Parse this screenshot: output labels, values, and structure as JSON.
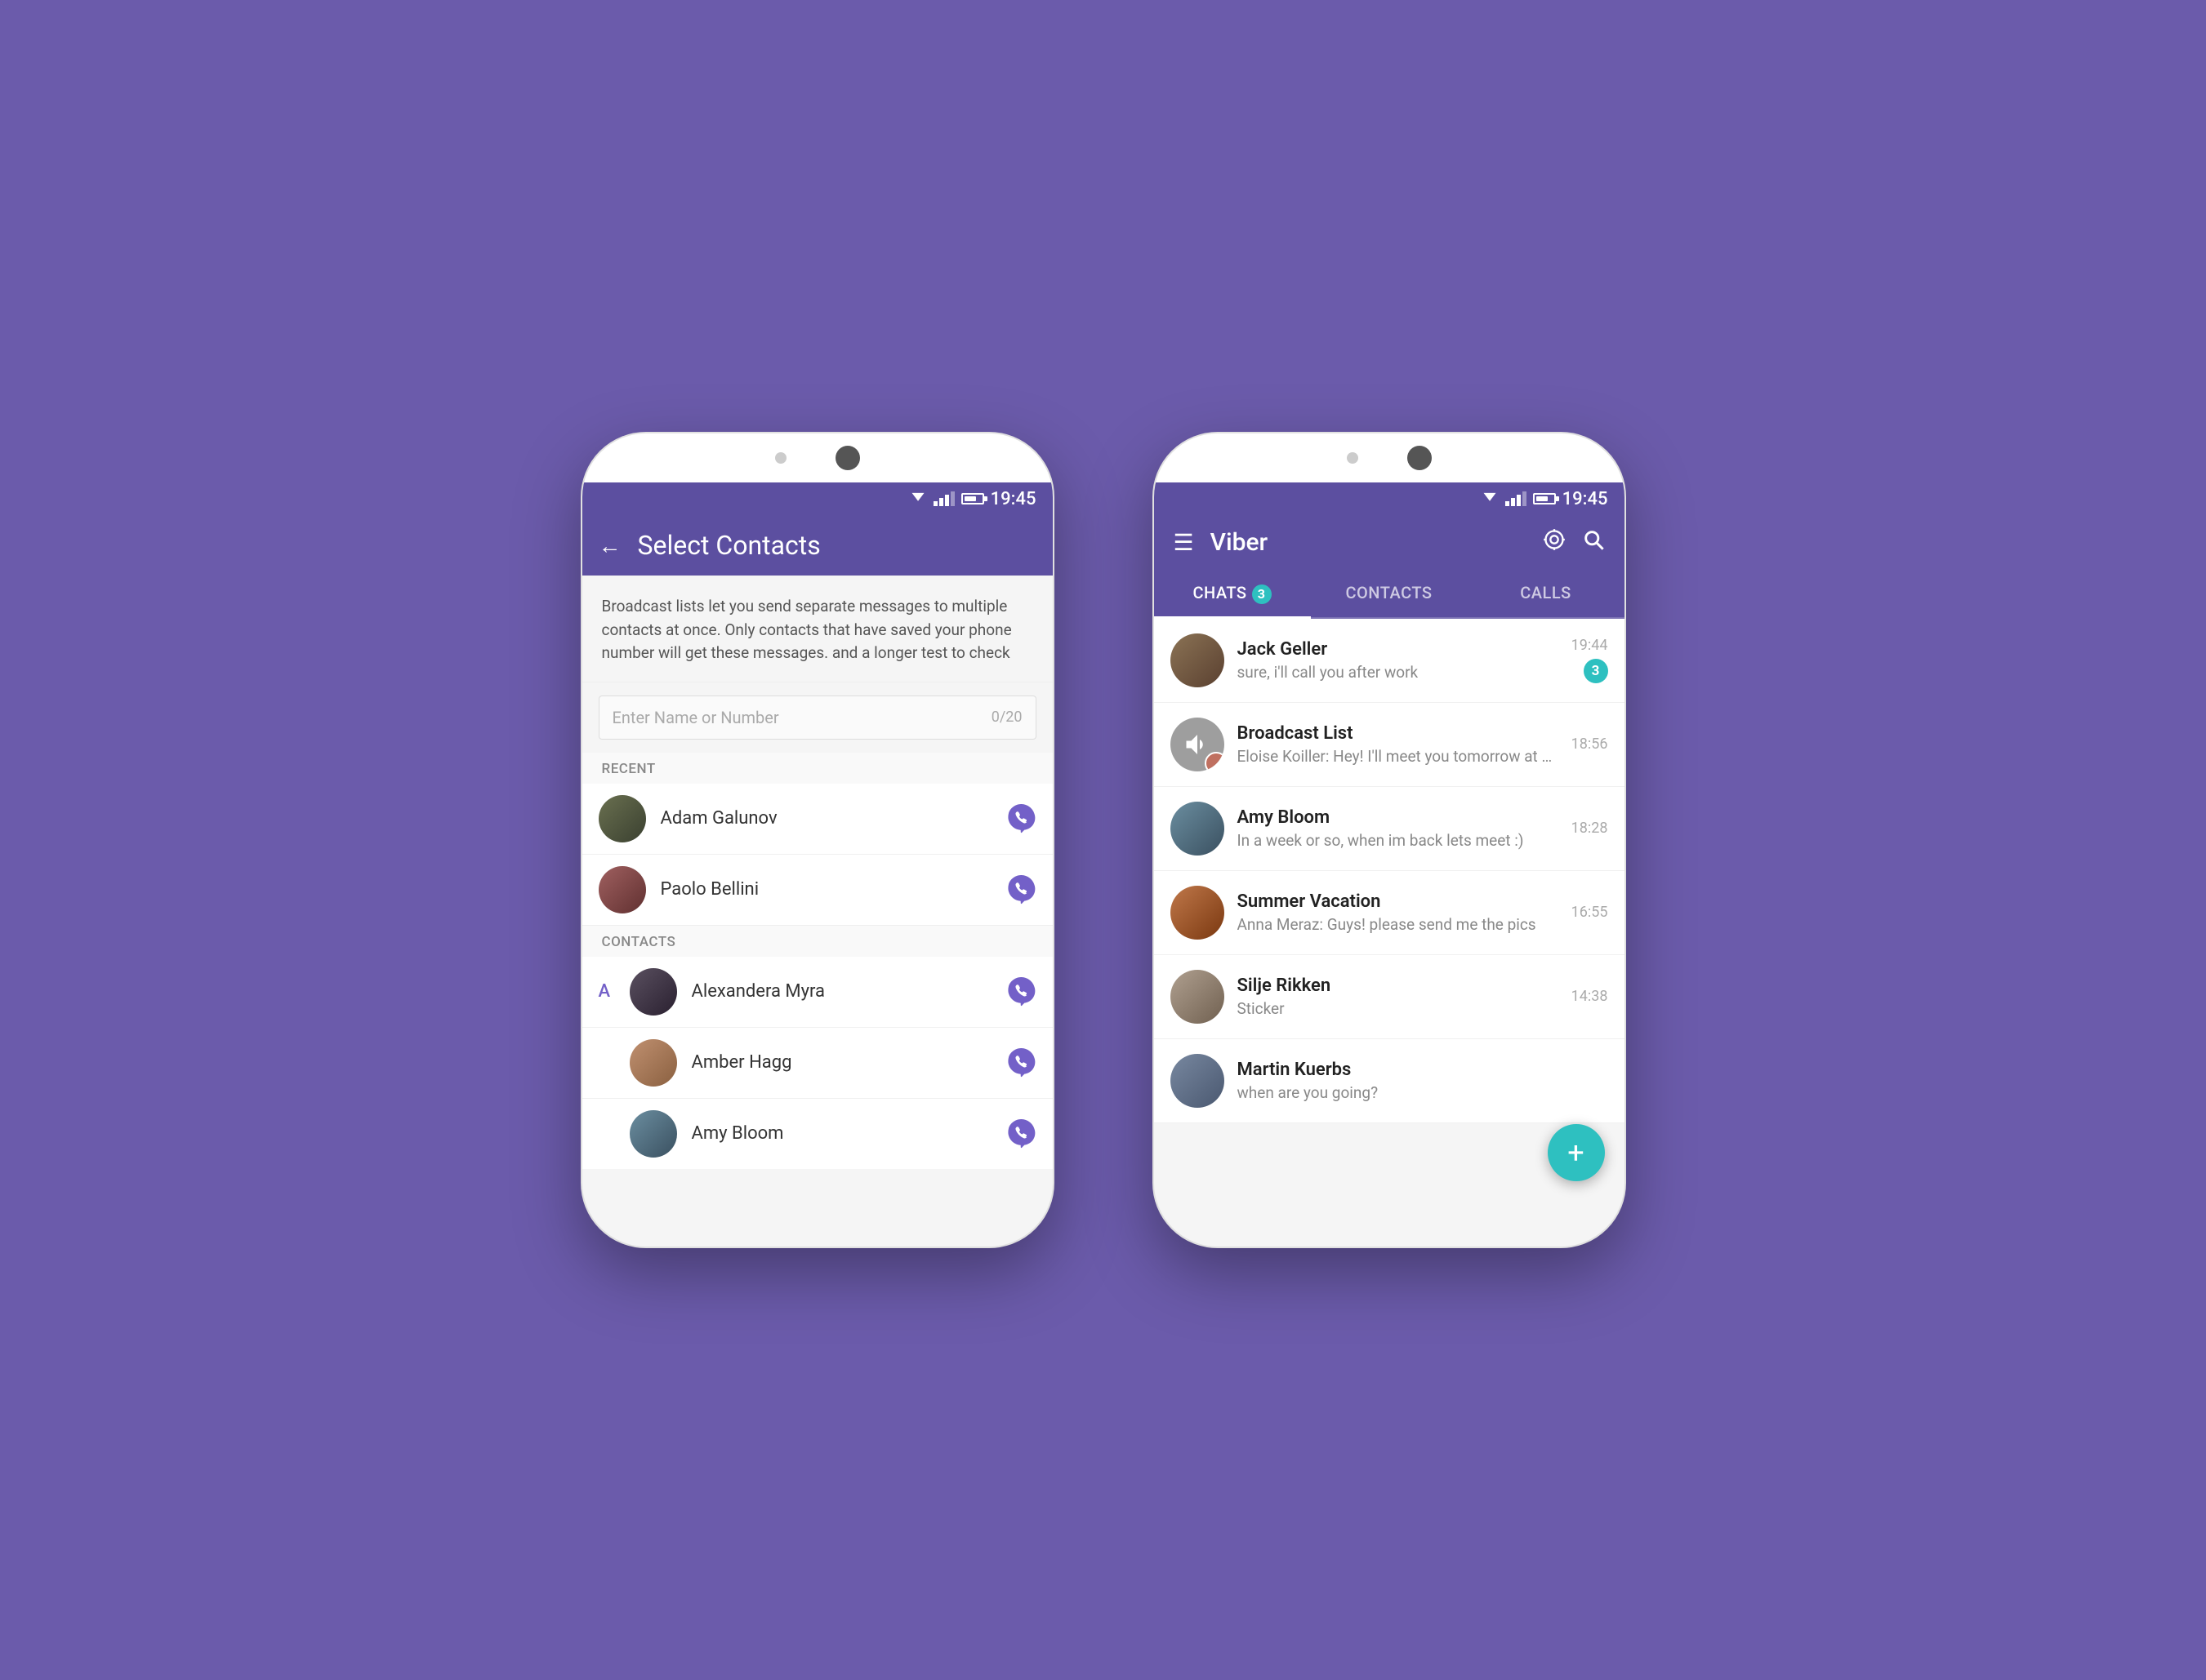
{
  "background_color": "#6b5bab",
  "phone1": {
    "status_time": "19:45",
    "header": {
      "title": "Select Contacts",
      "back_label": "←"
    },
    "broadcast_desc": "Broadcast lists let you send separate messages to multiple contacts at once. Only contacts that have saved your phone number will get these messages. and a longer test to check",
    "search": {
      "placeholder": "Enter Name or Number",
      "count": "0/20"
    },
    "sections": {
      "recent_label": "RECENT",
      "recent_contacts": [
        {
          "name": "Adam Galunov",
          "avatar_class": "av-adam"
        },
        {
          "name": "Paolo Bellini",
          "avatar_class": "av-paolo"
        }
      ],
      "contacts_label": "CONTACTS",
      "letter": "A",
      "contacts": [
        {
          "name": "Alexandera Myra",
          "avatar_class": "av-alex"
        },
        {
          "name": "Amber Hagg",
          "avatar_class": "av-amber"
        },
        {
          "name": "Amy Bloom",
          "avatar_class": "av-amyb"
        }
      ]
    }
  },
  "phone2": {
    "status_time": "19:45",
    "header": {
      "app_name": "Viber"
    },
    "tabs": [
      {
        "label": "CHATS",
        "badge": "3",
        "active": true
      },
      {
        "label": "CONTACTS",
        "badge": "",
        "active": false
      },
      {
        "label": "CALLS",
        "badge": "",
        "active": false
      }
    ],
    "chats": [
      {
        "name": "Jack Geller",
        "preview": "sure, i'll call you after work",
        "time": "19:44",
        "unread": "3",
        "avatar_class": "av-jack"
      },
      {
        "name": "Broadcast List",
        "preview": "Eloise Koiller: Hey! I'll meet you tomorrow at R...",
        "time": "18:56",
        "unread": "",
        "avatar_class": "broadcast",
        "is_broadcast": true
      },
      {
        "name": "Amy Bloom",
        "preview": "In a week or so, when im back lets meet :)",
        "time": "18:28",
        "unread": "",
        "avatar_class": "av-amy"
      },
      {
        "name": "Summer Vacation",
        "preview": "Anna Meraz: Guys! please send me the pics",
        "time": "16:55",
        "unread": "",
        "avatar_class": "av-summer"
      },
      {
        "name": "Silje Rikken",
        "preview": "Sticker",
        "time": "14:38",
        "unread": "",
        "avatar_class": "av-silje"
      },
      {
        "name": "Martin Kuerbs",
        "preview": "when are you going?",
        "time": "",
        "unread": "",
        "avatar_class": "av-martin"
      }
    ],
    "fab_label": "+"
  }
}
